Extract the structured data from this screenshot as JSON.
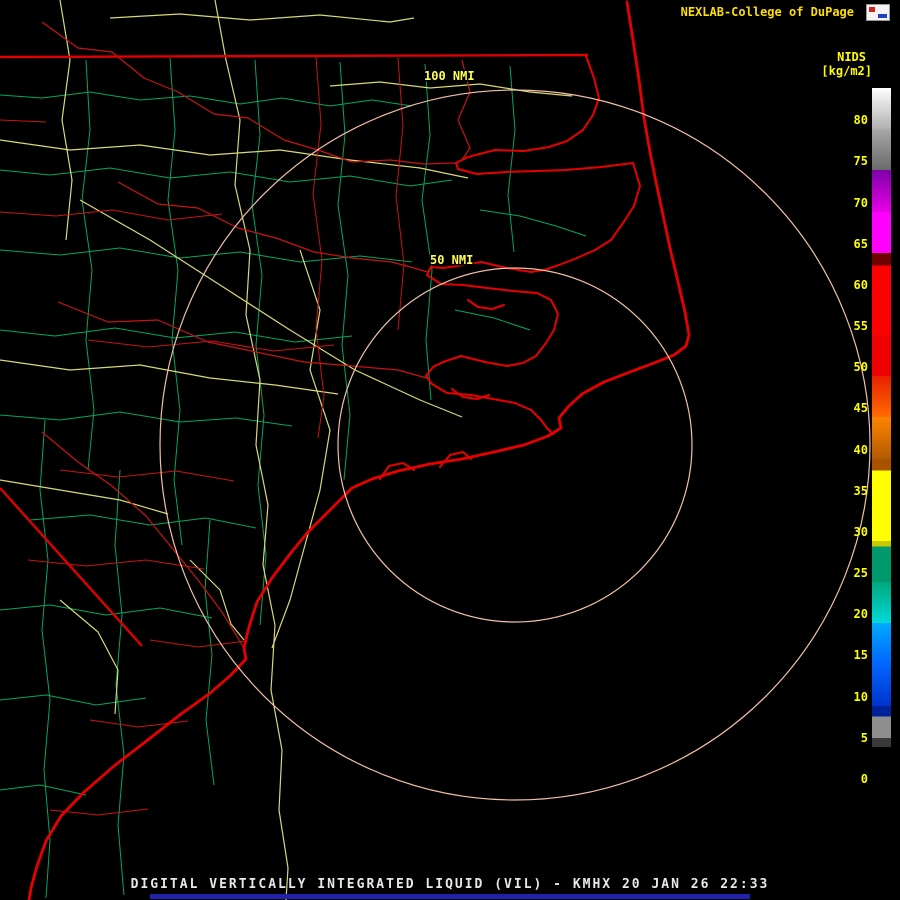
{
  "header": {
    "brand": "NEXLAB-College of DuPage",
    "product_code": "NIDS",
    "units": "[kg/m2]"
  },
  "map": {
    "range_ring_inner_label": "50 NMI",
    "range_ring_outer_label": "100 NMI",
    "radar_site": "KMHX"
  },
  "colorbar": {
    "labels": [
      "80",
      "75",
      "70",
      "65",
      "60",
      "55",
      "50",
      "45",
      "40",
      "35",
      "30",
      "25",
      "20",
      "15",
      "10",
      "5",
      "0"
    ],
    "segments": [
      {
        "value": "80",
        "css": "linear-gradient(#ffffff,#b0b0b0)"
      },
      {
        "value": "75",
        "css": "linear-gradient(#a8a8a8,#6a6a6a)"
      },
      {
        "value": "70",
        "css": "linear-gradient(#7d00a8,#e800e8)"
      },
      {
        "value": "65",
        "css": "#ff00ff"
      },
      {
        "value": "60",
        "css": "linear-gradient(#6f0000 0 30%,#ff0000 30%)"
      },
      {
        "value": "55",
        "css": "#ff0000"
      },
      {
        "value": "50",
        "css": "#f00000"
      },
      {
        "value": "45",
        "css": "linear-gradient(#e82000,#ff6a00)"
      },
      {
        "value": "40",
        "css": "linear-gradient(#ff8400,#b35b00)"
      },
      {
        "value": "35",
        "css": "linear-gradient(#a85200 0 28%,#ffff00 28%)"
      },
      {
        "value": "30",
        "css": "#ffff00"
      },
      {
        "value": "25",
        "css": "linear-gradient(#c8c800 0 14%,#00996b 14%)"
      },
      {
        "value": "20",
        "css": "linear-gradient(#00a87d,#00d9d9)"
      },
      {
        "value": "15",
        "css": "linear-gradient(#00aaff,#0066ff)"
      },
      {
        "value": "10",
        "css": "linear-gradient(#0066ff,#0033cc)"
      },
      {
        "value": "5",
        "css": "linear-gradient(#002299 0 26%,#8e8e8e 26% 78%,#3a3a3a 78%)"
      },
      {
        "value": "0",
        "css": "#000000"
      }
    ]
  },
  "footer": {
    "title": "DIGITAL VERTICALLY INTEGRATED LIQUID (VIL) - KMHX 20 JAN 26 22:33"
  },
  "colors": {
    "background": "#000000",
    "coastline": "#e80000",
    "county_lines": "#00a85e",
    "highways": "#d8d878",
    "range_rings": "#f2c0a6",
    "label_yellow": "#ffff00",
    "footer_text": "#e8e8e8",
    "footer_rule": "#2222a8"
  }
}
